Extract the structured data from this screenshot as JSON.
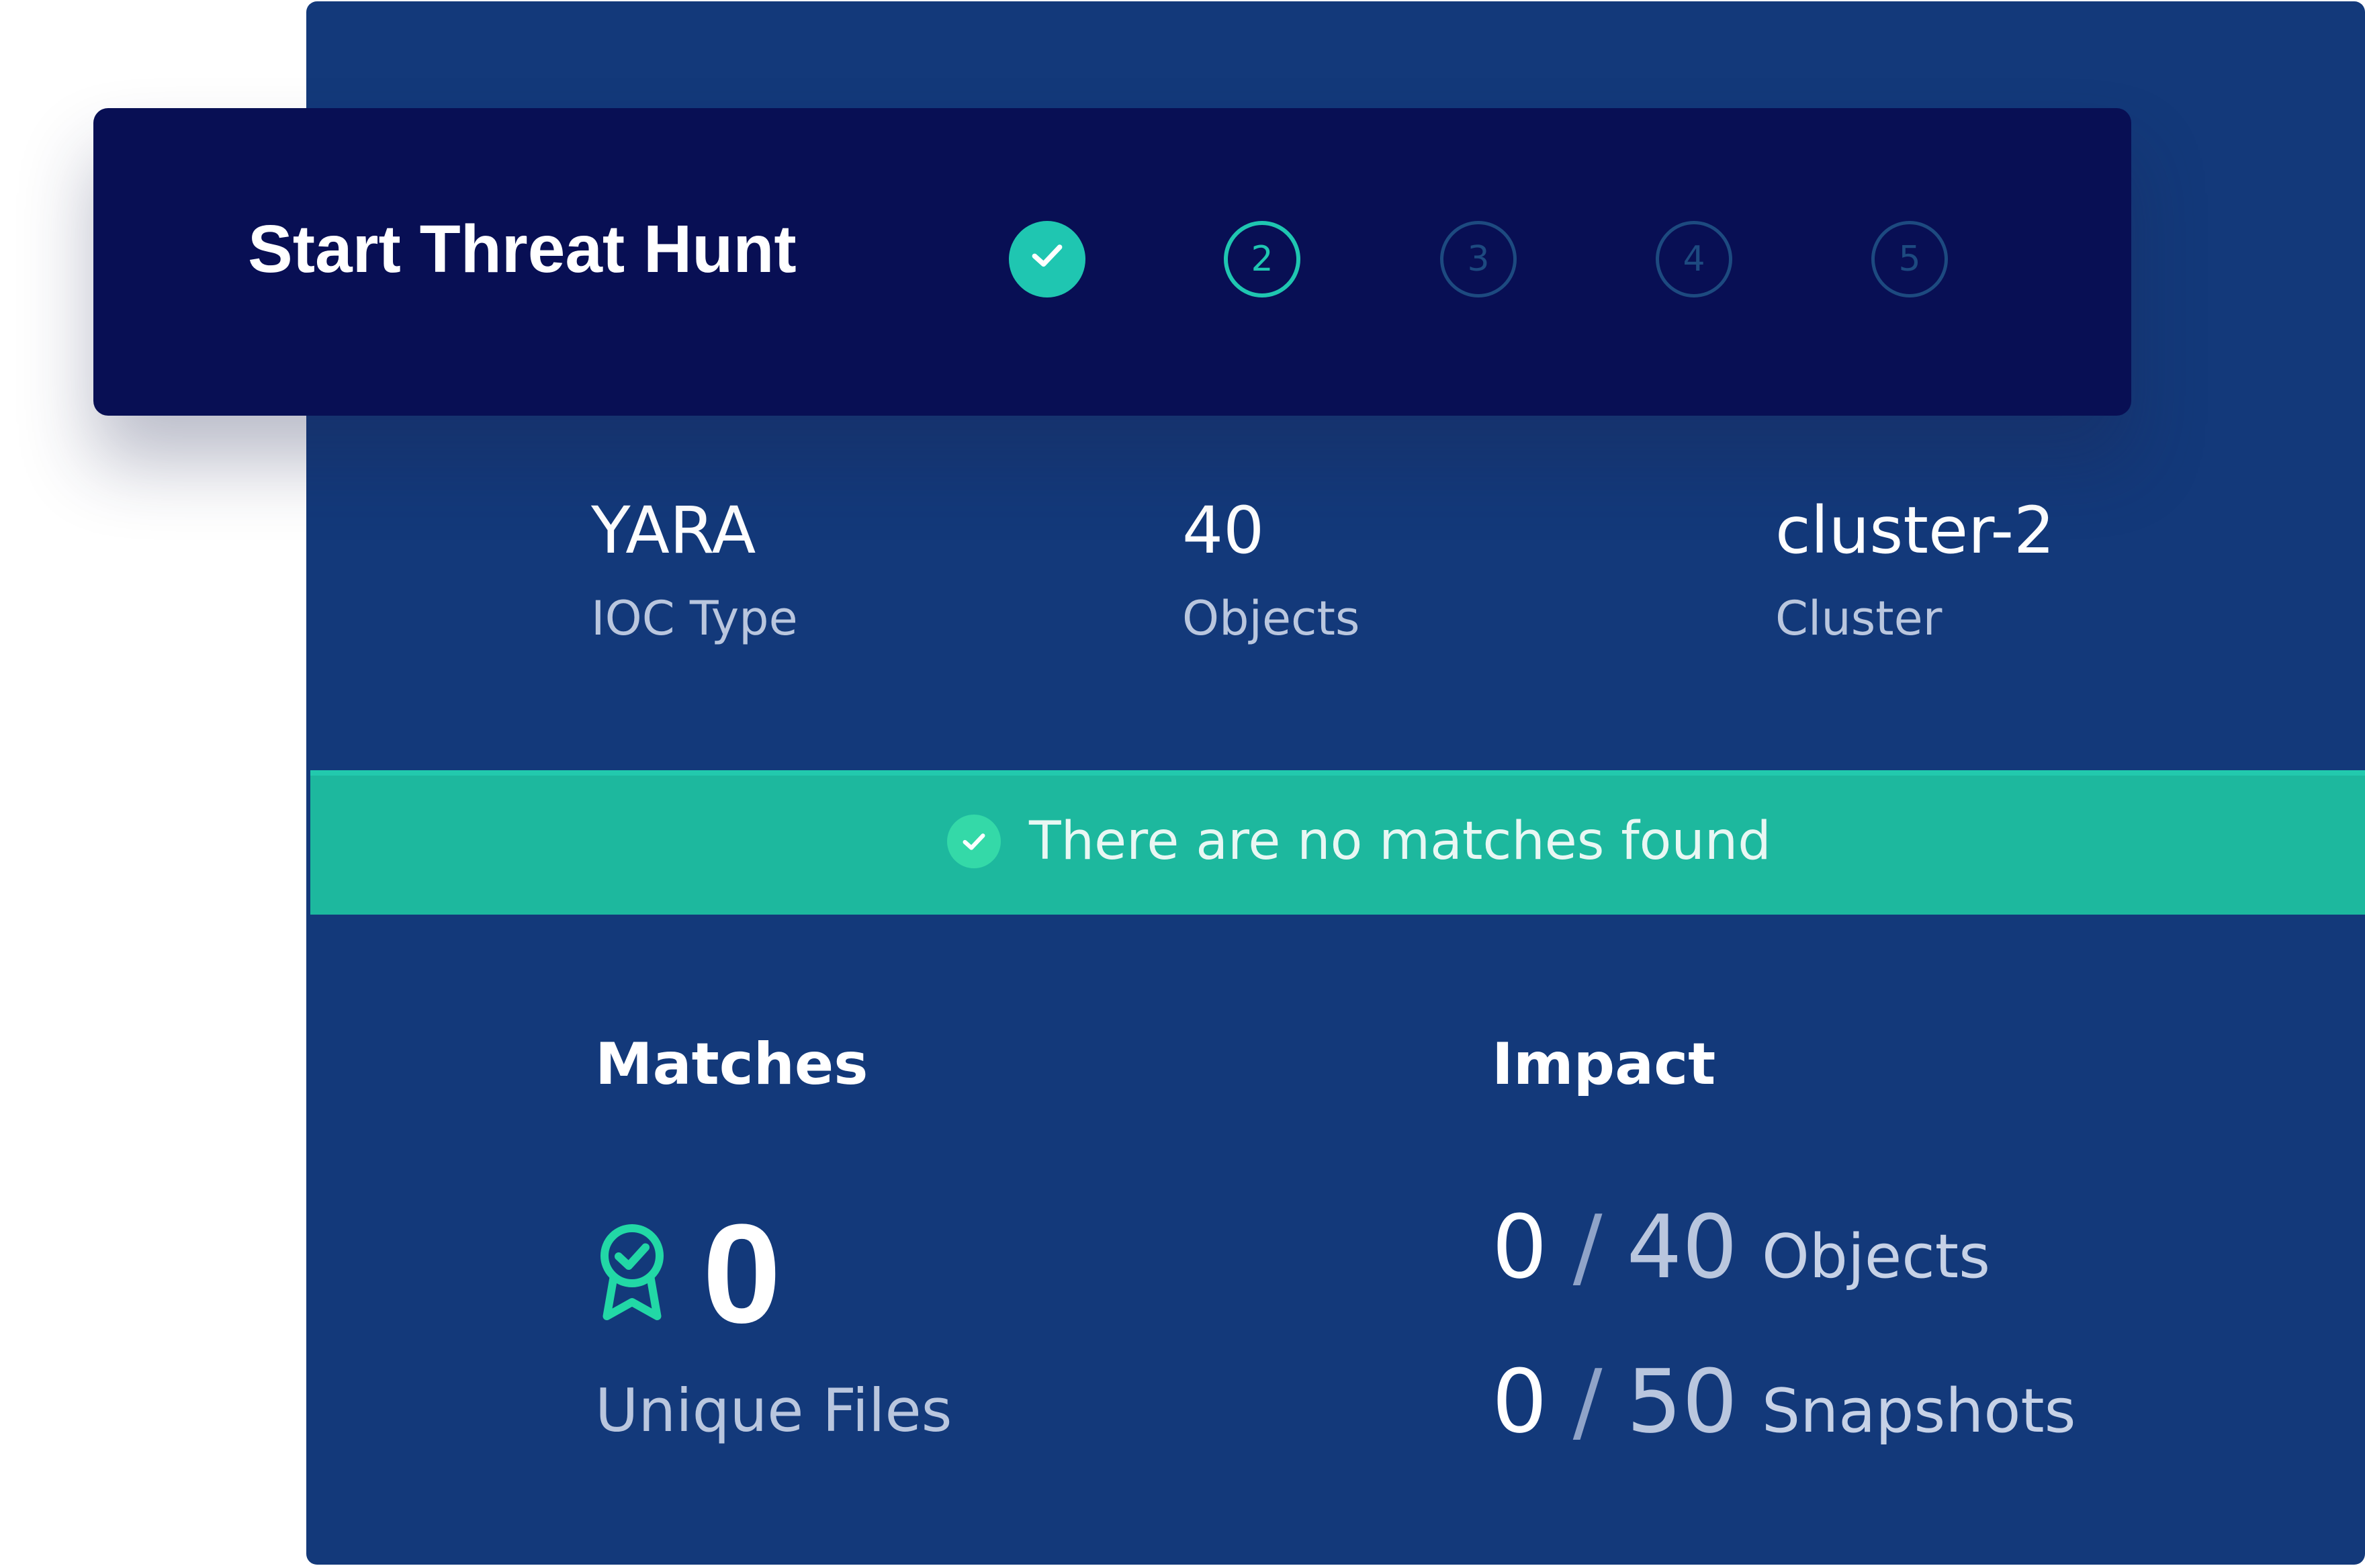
{
  "header": {
    "title": "Start Threat Hunt",
    "steps": [
      {
        "label": "",
        "state": "completed"
      },
      {
        "label": "2",
        "state": "current"
      },
      {
        "label": "3",
        "state": "upcoming"
      },
      {
        "label": "4",
        "state": "upcoming"
      },
      {
        "label": "5",
        "state": "upcoming"
      }
    ]
  },
  "summary": {
    "ioc": {
      "value": "YARA",
      "label": "IOC Type"
    },
    "objects": {
      "value": "40",
      "label": "Objects"
    },
    "cluster": {
      "value": "cluster-2",
      "label": "Cluster"
    }
  },
  "banner": {
    "icon": "check-circle-icon",
    "text": "There are no matches found"
  },
  "matches": {
    "title": "Matches",
    "icon": "award-ribbon-icon",
    "count": "0",
    "label": "Unique Files"
  },
  "impact": {
    "title": "Impact",
    "rows": [
      {
        "count": "0",
        "separator": "/",
        "total": "40",
        "unit": "Objects"
      },
      {
        "count": "0",
        "separator": "/",
        "total": "50",
        "unit": "Snapshots"
      }
    ]
  },
  "colors": {
    "card_background": "#13397a",
    "header_background": "#080f54",
    "accent": "#1fc6b1",
    "banner_background": "#1db89e"
  }
}
